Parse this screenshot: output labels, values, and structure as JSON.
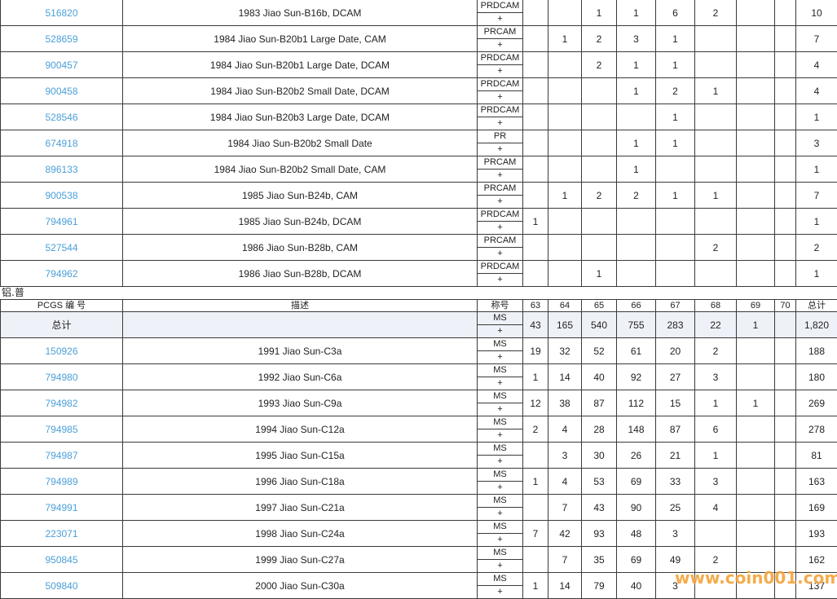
{
  "section1_rows": [
    {
      "id": "516820",
      "desc": "1983 Jiao Sun-B16b, DCAM",
      "grade": "PRDCAM",
      "plus": "+",
      "c": [
        "",
        "",
        "1",
        "1",
        "6",
        "2",
        "",
        "",
        "10"
      ]
    },
    {
      "id": "528659",
      "desc": "1984 Jiao Sun-B20b1 Large Date, CAM",
      "grade": "PRCAM",
      "plus": "+",
      "c": [
        "",
        "1",
        "2",
        "3",
        "1",
        "",
        "",
        "",
        "7"
      ]
    },
    {
      "id": "900457",
      "desc": "1984 Jiao Sun-B20b1 Large Date, DCAM",
      "grade": "PRDCAM",
      "plus": "+",
      "c": [
        "",
        "",
        "2",
        "1",
        "1",
        "",
        "",
        "",
        "4"
      ]
    },
    {
      "id": "900458",
      "desc": "1984 Jiao Sun-B20b2 Small Date, DCAM",
      "grade": "PRDCAM",
      "plus": "+",
      "c": [
        "",
        "",
        "",
        "1",
        "2",
        "1",
        "",
        "",
        "4"
      ]
    },
    {
      "id": "528546",
      "desc": "1984 Jiao Sun-B20b3 Large Date, DCAM",
      "grade": "PRDCAM",
      "plus": "+",
      "c": [
        "",
        "",
        "",
        "",
        "1",
        "",
        "",
        "",
        "1"
      ]
    },
    {
      "id": "674918",
      "desc": "1984 Jiao Sun-B20b2 Small Date",
      "grade": "PR",
      "plus": "+",
      "c": [
        "",
        "",
        "",
        "1",
        "1",
        "",
        "",
        "",
        "3"
      ]
    },
    {
      "id": "896133",
      "desc": "1984 Jiao Sun-B20b2 Small Date, CAM",
      "grade": "PRCAM",
      "plus": "+",
      "c": [
        "",
        "",
        "",
        "1",
        "",
        "",
        "",
        "",
        "1"
      ]
    },
    {
      "id": "900538",
      "desc": "1985 Jiao Sun-B24b, CAM",
      "grade": "PRCAM",
      "plus": "+",
      "c": [
        "",
        "1",
        "2",
        "2",
        "1",
        "1",
        "",
        "",
        "7"
      ]
    },
    {
      "id": "794961",
      "desc": "1985 Jiao Sun-B24b, DCAM",
      "grade": "PRDCAM",
      "plus": "+",
      "c": [
        "1",
        "",
        "",
        "",
        "",
        "",
        "",
        "",
        "1"
      ]
    },
    {
      "id": "527544",
      "desc": "1986 Jiao Sun-B28b, CAM",
      "grade": "PRCAM",
      "plus": "+",
      "c": [
        "",
        "",
        "",
        "",
        "",
        "2",
        "",
        "",
        "2"
      ]
    },
    {
      "id": "794962",
      "desc": "1986 Jiao Sun-B28b, DCAM",
      "grade": "PRDCAM",
      "plus": "+",
      "c": [
        "",
        "",
        "1",
        "",
        "",
        "",
        "",
        "",
        "1"
      ]
    }
  ],
  "section2_title": "铝.普",
  "section2_header": {
    "id": "PCGS 编 号",
    "desc": "描述",
    "grade": "称号",
    "cols": [
      "63",
      "64",
      "65",
      "66",
      "67",
      "68",
      "69",
      "70",
      "总计"
    ]
  },
  "section2_total": {
    "label": "总计",
    "grade": "MS",
    "plus": "+",
    "c": [
      "43",
      "165",
      "540",
      "755",
      "283",
      "22",
      "1",
      "",
      "1,820"
    ]
  },
  "section2_rows": [
    {
      "id": "150926",
      "desc": "1991 Jiao Sun-C3a",
      "grade": "MS",
      "plus": "+",
      "c": [
        "19",
        "32",
        "52",
        "61",
        "20",
        "2",
        "",
        "",
        "188"
      ]
    },
    {
      "id": "794980",
      "desc": "1992 Jiao Sun-C6a",
      "grade": "MS",
      "plus": "+",
      "c": [
        "1",
        "14",
        "40",
        "92",
        "27",
        "3",
        "",
        "",
        "180"
      ]
    },
    {
      "id": "794982",
      "desc": "1993 Jiao Sun-C9a",
      "grade": "MS",
      "plus": "+",
      "c": [
        "12",
        "38",
        "87",
        "112",
        "15",
        "1",
        "1",
        "",
        "269"
      ]
    },
    {
      "id": "794985",
      "desc": "1994 Jiao Sun-C12a",
      "grade": "MS",
      "plus": "+",
      "c": [
        "2",
        "4",
        "28",
        "148",
        "87",
        "6",
        "",
        "",
        "278"
      ]
    },
    {
      "id": "794987",
      "desc": "1995 Jiao Sun-C15a",
      "grade": "MS",
      "plus": "+",
      "c": [
        "",
        "3",
        "30",
        "26",
        "21",
        "1",
        "",
        "",
        "81"
      ]
    },
    {
      "id": "794989",
      "desc": "1996 Jiao Sun-C18a",
      "grade": "MS",
      "plus": "+",
      "c": [
        "1",
        "4",
        "53",
        "69",
        "33",
        "3",
        "",
        "",
        "163"
      ]
    },
    {
      "id": "794991",
      "desc": "1997 Jiao Sun-C21a",
      "grade": "MS",
      "plus": "+",
      "c": [
        "",
        "7",
        "43",
        "90",
        "25",
        "4",
        "",
        "",
        "169"
      ]
    },
    {
      "id": "223071",
      "desc": "1998 Jiao Sun-C24a",
      "grade": "MS",
      "plus": "+",
      "c": [
        "7",
        "42",
        "93",
        "48",
        "3",
        "",
        "",
        "",
        "193"
      ]
    },
    {
      "id": "950845",
      "desc": "1999 Jiao Sun-C27a",
      "grade": "MS",
      "plus": "+",
      "c": [
        "",
        "7",
        "35",
        "69",
        "49",
        "2",
        "",
        "",
        "162"
      ]
    },
    {
      "id": "509840",
      "desc": "2000 Jiao Sun-C30a",
      "grade": "MS",
      "plus": "+",
      "c": [
        "1",
        "14",
        "79",
        "40",
        "3",
        "",
        "",
        "",
        "137"
      ]
    }
  ],
  "watermark": "www.coin001.com",
  "colors": {
    "link": "#4a9fd8",
    "total_row_bg": "#eef1f7",
    "watermark": "#f5a338"
  }
}
